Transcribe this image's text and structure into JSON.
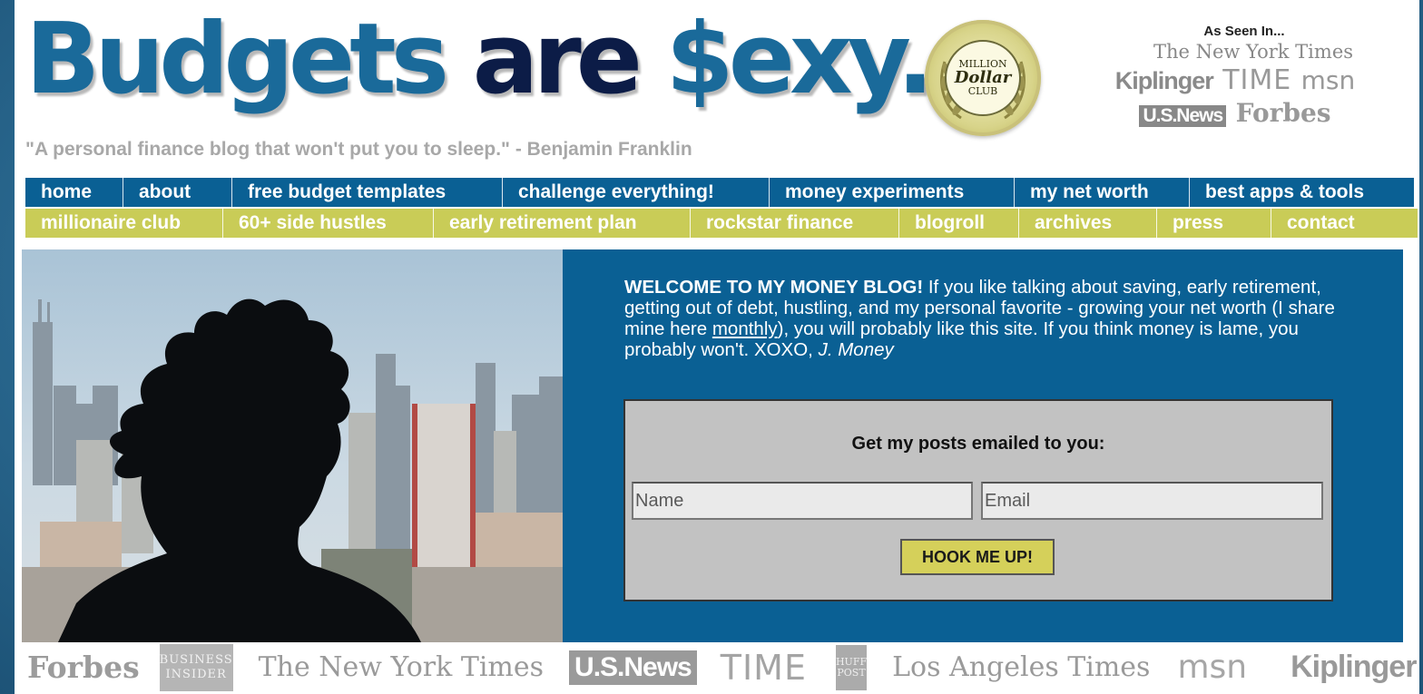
{
  "header": {
    "logo_word1": "Budgets",
    "logo_word2": "are",
    "logo_word3": "$exy.",
    "tagline": "\"A personal finance blog that won't put you to sleep.\" - Benjamin Franklin",
    "badge": {
      "line1": "MILLION",
      "line2": "Dollar",
      "line3": "CLUB"
    },
    "as_seen_in": {
      "title": "As Seen In...",
      "logos": {
        "nyt": "The New York Times",
        "kiplinger": "Kiplinger",
        "time": "TIME",
        "msn": "msn",
        "usnews": "U.S.News",
        "forbes": "Forbes"
      }
    }
  },
  "nav_primary": [
    "home",
    "about",
    "free budget templates",
    "challenge everything!",
    "money experiments",
    "my net worth",
    "best apps & tools"
  ],
  "nav_secondary": [
    "millionaire club",
    "60+ side hustles",
    "early retirement plan",
    "rockstar finance",
    "blogroll",
    "archives",
    "press",
    "contact"
  ],
  "welcome": {
    "lead": "WELCOME TO MY MONEY BLOG!",
    "body1": " If you like talking about saving, early retirement, getting out of debt, hustling, and my personal favorite - growing your net worth (I share mine here ",
    "link": "monthly",
    "body2": "), you will probably like this site. If you think money is lame, you probably won't. XOXO, ",
    "signature": "J. Money"
  },
  "subscribe": {
    "title": "Get my posts emailed to you:",
    "name_placeholder": "Name",
    "email_placeholder": "Email",
    "button_label": "HOOK ME UP!"
  },
  "press_strip": {
    "forbes": "Forbes",
    "business_insider_line1": "BUSINESS",
    "business_insider_line2": "INSIDER",
    "nyt": "The New York Times",
    "usnews": "U.S.News",
    "time": "TIME",
    "huff_line1": "HUFF",
    "huff_line2": "POST",
    "latimes": "Los Angeles Times",
    "msn": "msn",
    "kiplinger": "Kiplinger"
  },
  "colors": {
    "brand_blue": "#0a6094",
    "nav_green": "#c9cc57",
    "logo_navy": "#0c1c47",
    "button_yellow": "#d5d05a"
  }
}
